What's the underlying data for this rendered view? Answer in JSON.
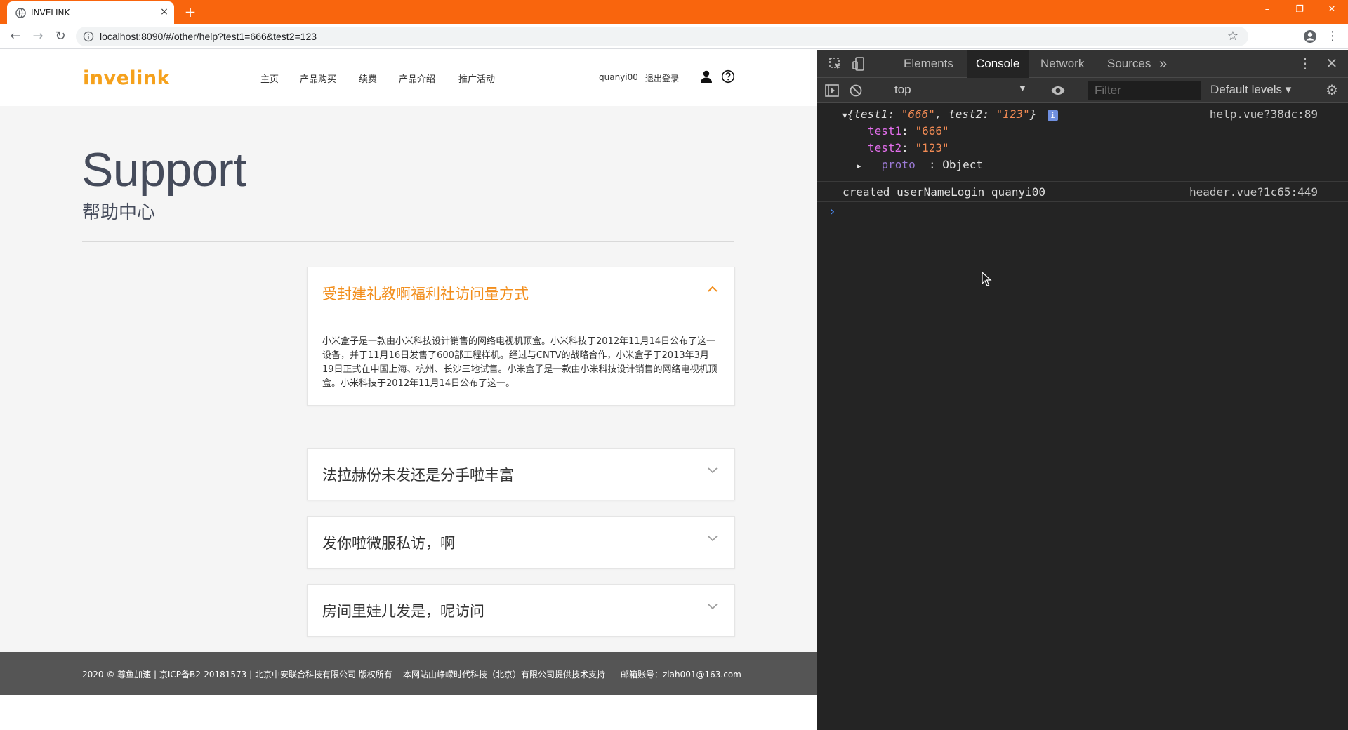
{
  "browser": {
    "tab_title": "INVELINK",
    "tab_close": "×",
    "new_tab": "+",
    "url": "localhost:8090/#/other/help?test1=666&test2=123",
    "window_controls": [
      "–",
      "❐",
      "✕"
    ]
  },
  "site": {
    "logo": "invelink",
    "nav": [
      "主页",
      "产品购买",
      "续费",
      "产品介绍",
      "推广活动"
    ],
    "user_name": "quanyi00",
    "logout": "退出登录",
    "title": "Support",
    "subtitle": "帮助中心",
    "faqs": [
      {
        "question": "受封建礼教啊福利社访问量方式",
        "expanded": true,
        "answer": "小米盒子是一款由小米科技设计销售的网络电视机顶盒。小米科技于2012年11月14日公布了这一设备，并于11月16日发售了600部工程样机。经过与CNTV的战略合作，小米盒子于2013年3月19日正式在中国上海、杭州、长沙三地试售。小米盒子是一款由小米科技设计销售的网络电视机顶盒。小米科技于2012年11月14日公布了这一。"
      },
      {
        "question": "法拉赫份未发还是分手啦丰富",
        "expanded": false
      },
      {
        "question": "发你啦微服私访，啊",
        "expanded": false
      },
      {
        "question": "房间里娃儿发是，呢访问",
        "expanded": false
      }
    ],
    "footer": {
      "copyright": "2020 © 尊鱼加速 | 京ICP备B2-20181573 | 北京中安联合科技有限公司 版权所有",
      "support": "本网站由峥嵘时代科技（北京）有限公司提供技术支持",
      "email": "邮箱账号：zlah001@163.com"
    },
    "accent_color": "#f28e1c"
  },
  "devtools": {
    "tabs": [
      "Elements",
      "Console",
      "Network",
      "Sources"
    ],
    "more_tabs": "»",
    "active_tab": "Console",
    "context": "top",
    "filter_placeholder": "Filter",
    "levels": "Default levels",
    "console": {
      "obj_summary_open": "{",
      "obj_key1": "test1",
      "obj_val1": "\"666\"",
      "obj_key2": "test2",
      "obj_val2": "\"123\"",
      "obj_summary_close": "}",
      "obj_source": "help.vue?38dc:89",
      "prop1_key": "test1",
      "prop1_val": "\"666\"",
      "prop2_key": "test2",
      "prop2_val": "\"123\"",
      "proto_key": "__proto__",
      "proto_val": "Object",
      "log_text": "created userNameLogin quanyi00",
      "log_source": "header.vue?1c65:449",
      "prompt": "›"
    }
  }
}
